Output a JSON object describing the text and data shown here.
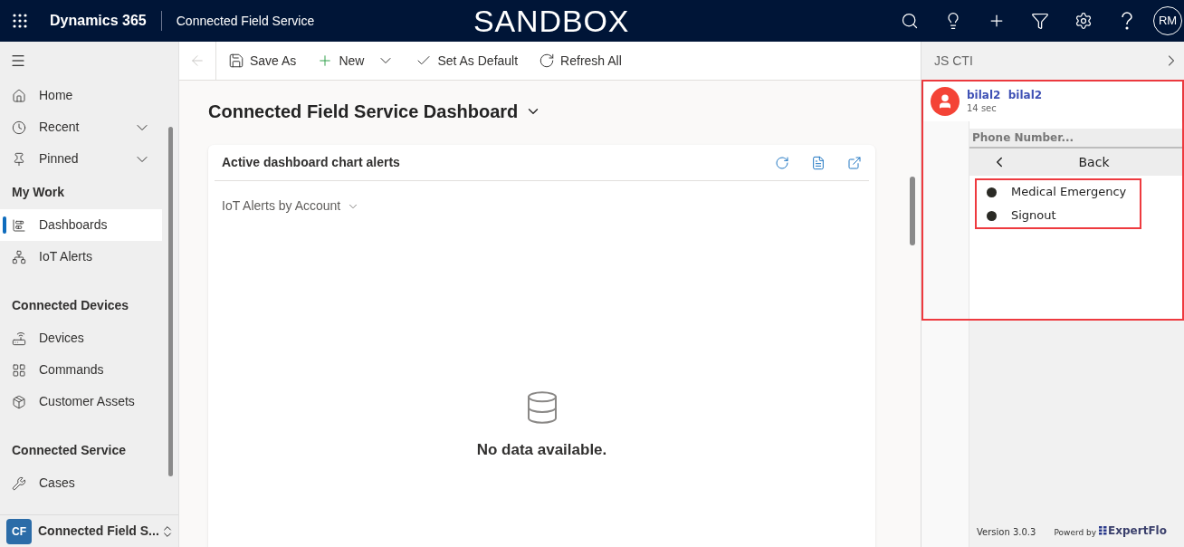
{
  "top_bar": {
    "brand": "Dynamics 365",
    "app_name": "Connected Field Service",
    "environment": "SANDBOX",
    "avatar": "RM"
  },
  "sidebar": {
    "groups": [
      {
        "items": [
          {
            "label": "Home",
            "selected": false,
            "expandable": false
          },
          {
            "label": "Recent",
            "selected": false,
            "expandable": true
          },
          {
            "label": "Pinned",
            "selected": false,
            "expandable": true
          }
        ]
      },
      {
        "heading": "My Work",
        "items": [
          {
            "label": "Dashboards",
            "selected": true,
            "expandable": false
          },
          {
            "label": "IoT Alerts",
            "selected": false,
            "expandable": false
          }
        ]
      },
      {
        "heading": "Connected Devices",
        "items": [
          {
            "label": "Devices",
            "selected": false,
            "expandable": false
          },
          {
            "label": "Commands",
            "selected": false,
            "expandable": false
          },
          {
            "label": "Customer Assets",
            "selected": false,
            "expandable": false
          }
        ]
      },
      {
        "heading": "Connected Service",
        "items": [
          {
            "label": "Cases",
            "selected": false,
            "expandable": false
          }
        ]
      }
    ],
    "area": {
      "badge": "CF",
      "label": "Connected Field S..."
    }
  },
  "toolbar": [
    {
      "label": "Save As",
      "dropdown": false
    },
    {
      "label": "New",
      "dropdown": true
    },
    {
      "label": "Set As Default",
      "dropdown": false
    },
    {
      "label": "Refresh All",
      "dropdown": false
    }
  ],
  "dashboard": {
    "title": "Connected Field Service Dashboard",
    "card": {
      "title": "Active dashboard chart alerts",
      "view": "IoT Alerts by Account",
      "empty_message": "No data available."
    }
  },
  "cti_panel": {
    "title": "JS CTI",
    "annotated": true,
    "caller": {
      "name": "bilal2  bilal2",
      "duration": "14 sec"
    },
    "phone_field": {
      "placeholder": "Phone Number..."
    },
    "back": "Back",
    "options_annotated": true,
    "options": [
      {
        "label": "Medical Emergency"
      },
      {
        "label": "Signout"
      }
    ],
    "version": "Version 3.0.3",
    "powered_by": "Powerd by",
    "vendor": "ExpertFlo"
  }
}
